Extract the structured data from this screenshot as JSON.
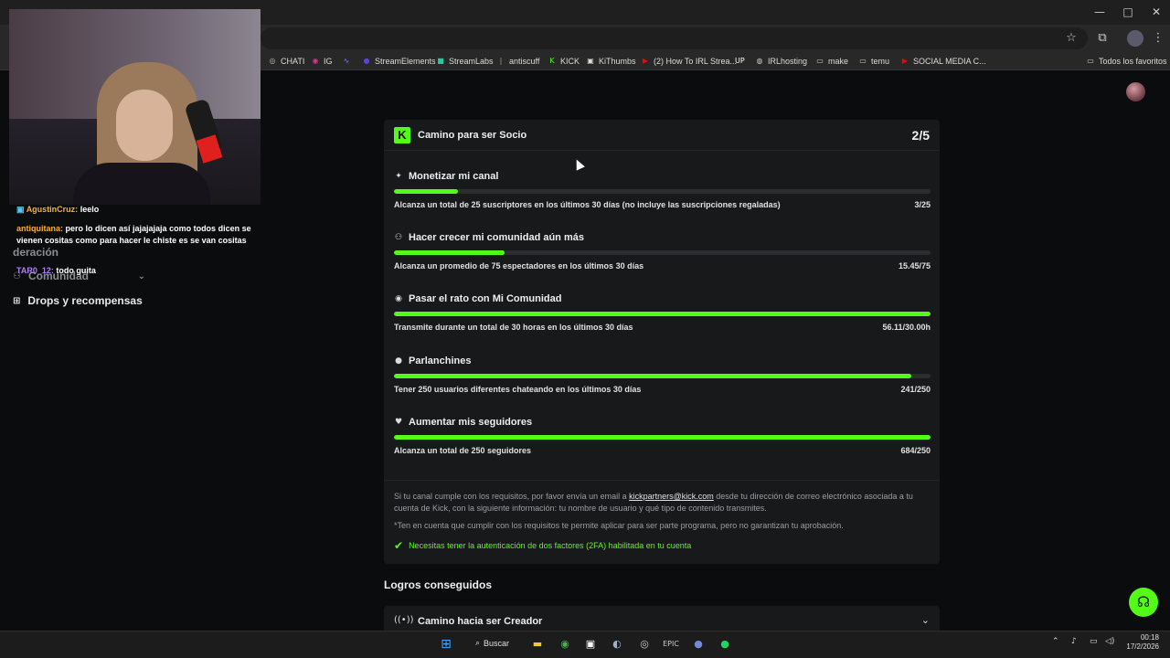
{
  "browser": {
    "window_buttons": {
      "minimize": "—",
      "maximize": "□",
      "close": "✕"
    },
    "bookmarks": [
      {
        "label": "CHATI",
        "icon": "chat-icon",
        "glyph": "◎",
        "color": "#bbbbbb"
      },
      {
        "label": "IG",
        "icon": "instagram-icon",
        "glyph": "◉",
        "color": "#d6398a"
      },
      {
        "label": "",
        "icon": "chart-icon",
        "glyph": "∿",
        "color": "#7d7dff"
      },
      {
        "label": "StreamElements",
        "icon": "streamelements-icon",
        "glyph": "●",
        "color": "#5a43d6"
      },
      {
        "label": "StreamLabs",
        "icon": "streamlabs-icon",
        "glyph": "■",
        "color": "#31c3a2"
      },
      {
        "label": "antiscuff",
        "icon": "antiscuff-icon",
        "glyph": "|",
        "color": "#9aa0a6"
      },
      {
        "label": "KICK",
        "icon": "kick-icon",
        "glyph": "K",
        "color": "#53fc18"
      },
      {
        "label": "KiThumbs",
        "icon": "kithumbs-icon",
        "glyph": "▣",
        "color": "#dddddd"
      },
      {
        "label": "(2) How To IRL Strea...",
        "icon": "youtube-icon",
        "glyph": "▶",
        "color": "#ff0000"
      },
      {
        "label": "",
        "icon": "up-icon",
        "glyph": "UP",
        "color": "#ffffff"
      },
      {
        "label": "IRLhosting",
        "icon": "globe-icon",
        "glyph": "◍",
        "color": "#cccccc"
      },
      {
        "label": "make",
        "icon": "folder-icon",
        "glyph": "▭",
        "color": "#cccccc"
      },
      {
        "label": "temu",
        "icon": "folder-icon",
        "glyph": "▭",
        "color": "#cccccc"
      },
      {
        "label": "SOCIAL MEDIA C...",
        "icon": "youtube-icon",
        "glyph": "▶",
        "color": "#ff0000"
      }
    ],
    "all_bookmarks_label": "Todos los favoritos"
  },
  "chat": [
    {
      "user": "AgustinCruz:",
      "user_color": "#f5b03a",
      "message": "leelo"
    },
    {
      "user": "antiquitana:",
      "user_color": "#f5b03a",
      "message": "pero lo dicen así jajajajaja como todos dicen se vienen cositas como para hacer le chiste es se van cositas"
    },
    {
      "user": "TAR0_12:",
      "user_color": "#b07ef5",
      "message": "todo guita"
    }
  ],
  "left_nav": {
    "moderation": "deración",
    "community": "Comunidad",
    "drops": "Drops y recompensas"
  },
  "partner_card": {
    "title": "Camino para ser Socio",
    "progress": "2/5",
    "requirements": [
      {
        "icon": "sparkle-icon",
        "glyph": "✦",
        "title": "Monetizar mi canal",
        "description": "Alcanza un total de 25 suscriptores en los últimos 30 días (no incluye las suscripciones regaladas)",
        "value": "3/25",
        "fraction": 0.12
      },
      {
        "icon": "community-icon",
        "glyph": "⚇",
        "title": "Hacer crecer mi comunidad aún más",
        "description": "Alcanza un promedio de 75 espectadores en los últimos 30 días",
        "value": "15.45/75",
        "fraction": 0.206
      },
      {
        "icon": "broadcast-icon",
        "glyph": "◉",
        "title": "Pasar el rato con Mi Comunidad",
        "description": "Transmite durante un total de 30 horas en los últimos 30 días",
        "value": "56.11/30.00h",
        "fraction": 1.0
      },
      {
        "icon": "chat-bubble-icon",
        "glyph": "●",
        "title": "Parlanchines",
        "description": "Tener 250 usuarios diferentes chateando en los últimos 30 días",
        "value": "241/250",
        "fraction": 0.964
      },
      {
        "icon": "heart-icon",
        "glyph": "♥",
        "title": "Aumentar mis seguidores",
        "description": "Alcanza un total de 250 seguidores",
        "value": "684/250",
        "fraction": 1.0
      }
    ],
    "note_before_email": "Si tu canal cumple con los requisitos, por favor envía un email a ",
    "email": "kickpartners@kick.com",
    "note_after_email": " desde tu dirección de correo electrónico asociada a tu cuenta de Kick, con la siguiente información: tu nombre de usuario y qué tipo de contenido transmites.",
    "disclaimer": "*Ten en cuenta que cumplir con los requisitos te permite aplicar para ser parte programa, pero no garantizan tu aprobación.",
    "twofa": "Necesitas tener la autenticación de dos factores (2FA) habilitada en tu cuenta"
  },
  "achievements_title": "Logros conseguidos",
  "creator_card": {
    "title": "Camino hacia ser Creador"
  },
  "taskbar": {
    "search_label": "Buscar",
    "time": "00:18",
    "date": "17/2/2026"
  },
  "colors": {
    "accent": "#53fc18",
    "card_bg": "#18191b",
    "page_bg": "#0b0c0d"
  }
}
